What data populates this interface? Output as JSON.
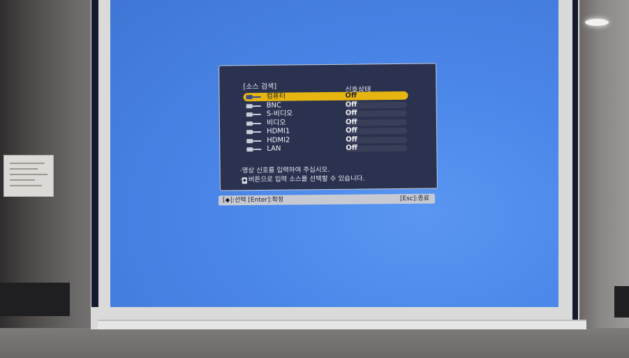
{
  "osd": {
    "title": "[소스 검색]",
    "status_header": "신호상태",
    "sources": [
      {
        "label": "컴퓨터",
        "status": "Off",
        "selected": true,
        "icon": "computer-port-icon"
      },
      {
        "label": "BNC",
        "status": "Off",
        "selected": false,
        "icon": "bnc-port-icon"
      },
      {
        "label": "S-비디오",
        "status": "Off",
        "selected": false,
        "icon": "s-video-port-icon"
      },
      {
        "label": "비디오",
        "status": "Off",
        "selected": false,
        "icon": "video-port-icon"
      },
      {
        "label": "HDMI1",
        "status": "Off",
        "selected": false,
        "icon": "hdmi-port-icon"
      },
      {
        "label": "HDMI2",
        "status": "Off",
        "selected": false,
        "icon": "hdmi-port-icon"
      },
      {
        "label": "LAN",
        "status": "Off",
        "selected": false,
        "icon": "lan-port-icon"
      }
    ],
    "message_1": "·영상 신호를 입력하여 주십시오.",
    "message_2": "버튼으로 입력 소스를 선택할 수 있습니다.",
    "message_2_prefix": "·"
  },
  "key_bar": {
    "left": "[◆]:선택 [Enter]:확정",
    "right": "[Esc]:종료"
  },
  "colors": {
    "projection": "#4a86e8",
    "osd_background": "#2a3250",
    "selection": "#e6b510"
  }
}
